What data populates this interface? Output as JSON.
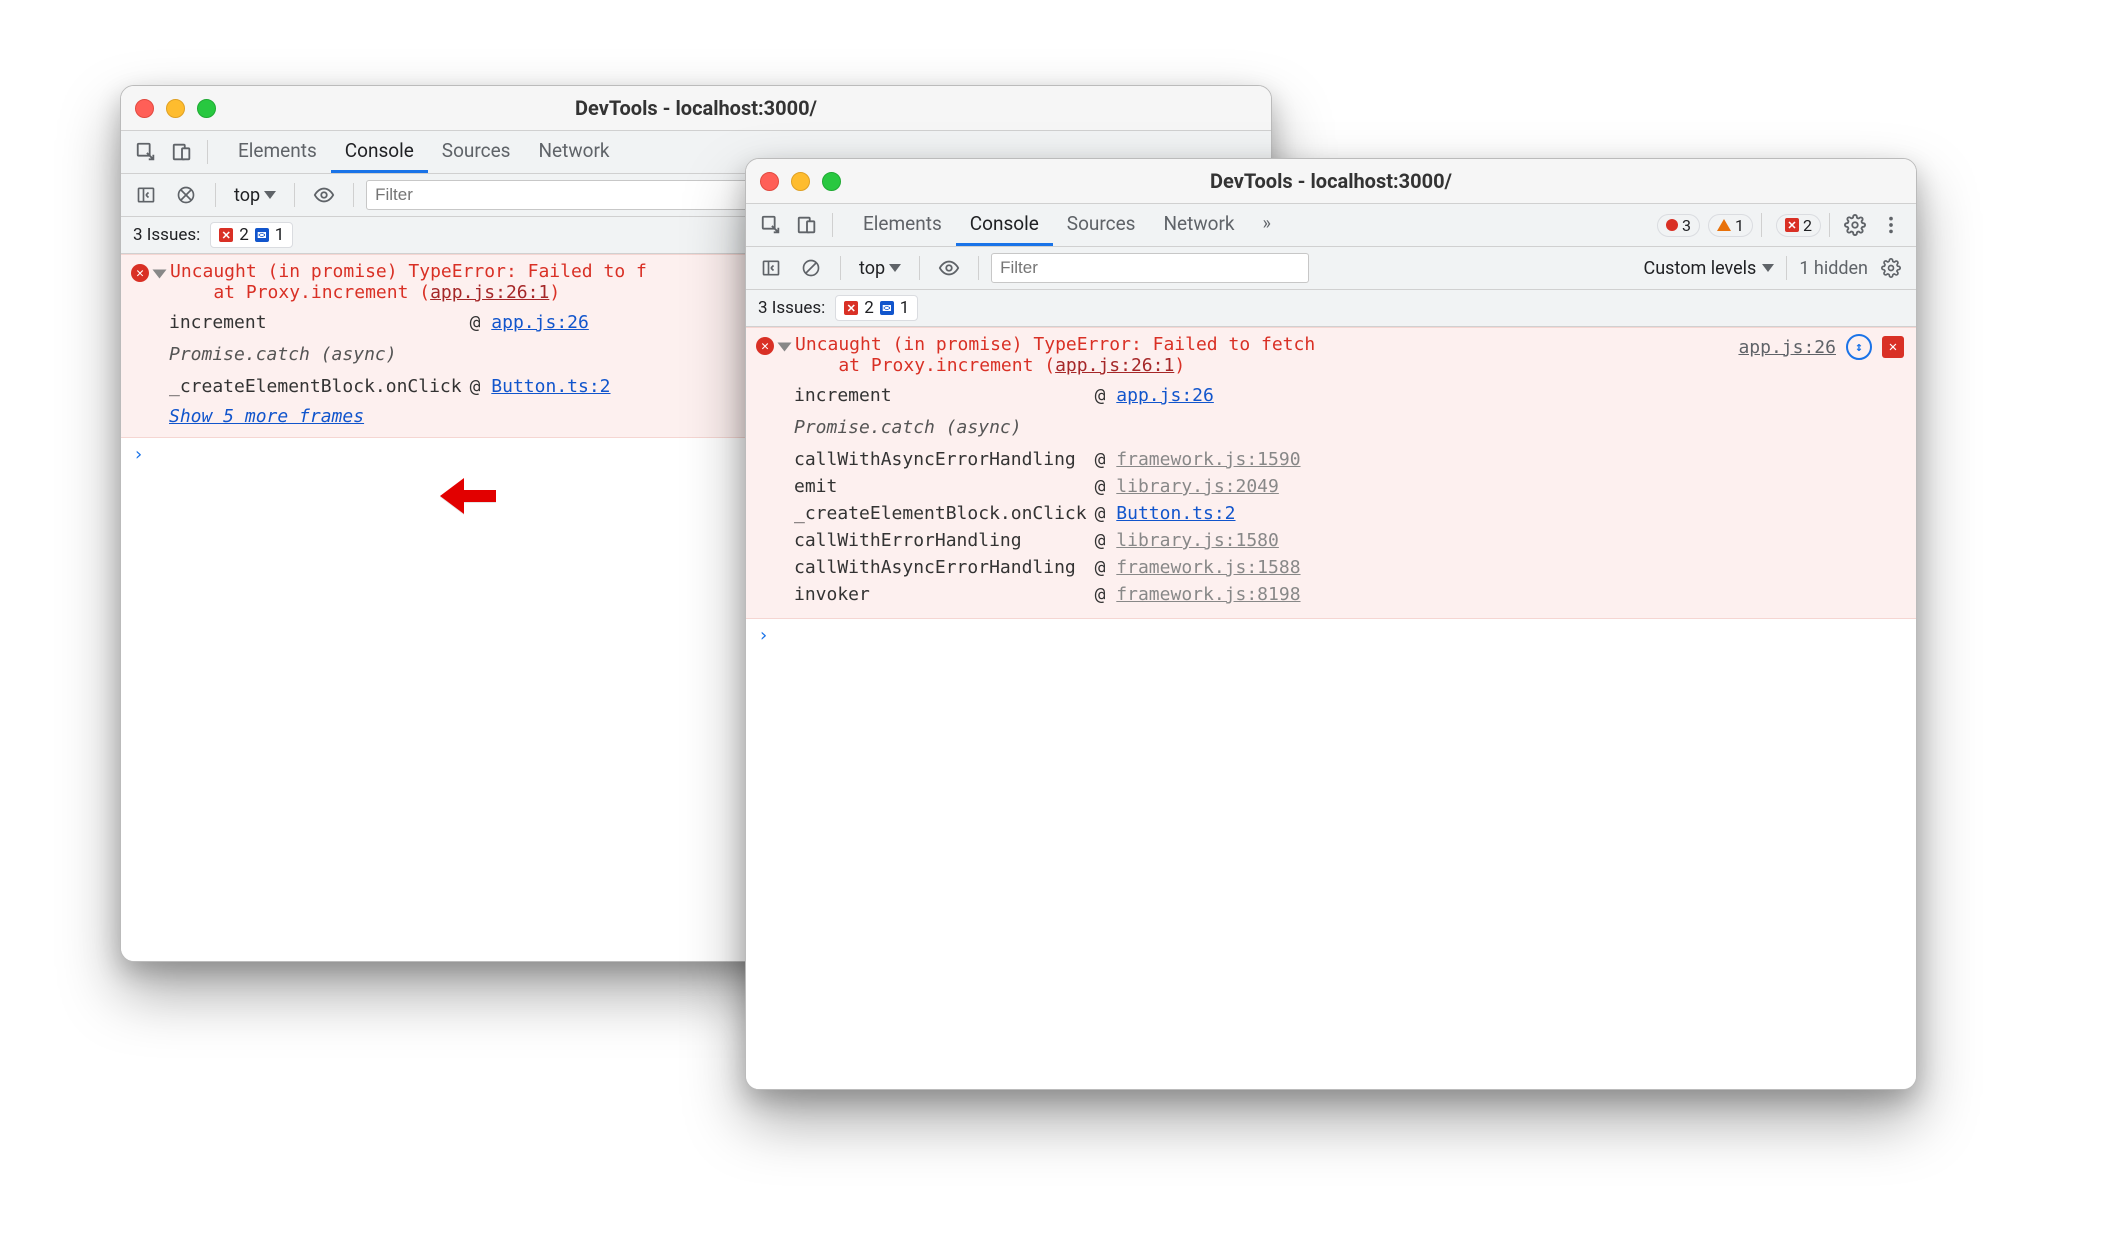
{
  "window_back": {
    "title": "DevTools - localhost:3000/",
    "tabs": {
      "elements": "Elements",
      "console": "Console",
      "sources": "Sources",
      "network": "Network"
    },
    "context": "top",
    "filter_placeholder": "Filter",
    "issues_label": "3 Issues:",
    "issues_err_count": "2",
    "issues_msg_count": "1",
    "error_header": "Uncaught (in promise) TypeError: Failed to f\n    at Proxy.increment (",
    "error_src_label": "app.js:26:1",
    "error_tail": ")",
    "stack": [
      {
        "fn": "increment",
        "at": "@",
        "loc": "app.js:26"
      }
    ],
    "async_label": "Promise.catch (async)",
    "stack2": [
      {
        "fn": "_createElementBlock.onClick",
        "at": "@",
        "loc": "Button.ts:2"
      }
    ],
    "show_more": "Show 5 more frames",
    "prompt": "›"
  },
  "window_front": {
    "title": "DevTools - localhost:3000/",
    "tabs": {
      "elements": "Elements",
      "console": "Console",
      "sources": "Sources",
      "network": "Network"
    },
    "counts": {
      "errors": "3",
      "warnings": "1",
      "redsq": "2"
    },
    "context": "top",
    "filter_placeholder": "Filter",
    "custom_levels": "Custom levels",
    "hidden": "1 hidden",
    "issues_label": "3 Issues:",
    "issues_err_count": "2",
    "issues_msg_count": "1",
    "error_header": "Uncaught (in promise) TypeError: Failed to fetch\n    at Proxy.increment (",
    "error_src_label": "app.js:26:1",
    "error_tail": ")",
    "right_src": "app.js:26",
    "stack": [
      {
        "fn": "increment",
        "at": "@",
        "loc": "app.js:26",
        "link_strong": true
      }
    ],
    "async_label": "Promise.catch (async)",
    "stack2": [
      {
        "fn": "callWithAsyncErrorHandling",
        "at": "@",
        "loc": "framework.js:1590"
      },
      {
        "fn": "emit",
        "at": "@",
        "loc": "library.js:2049"
      },
      {
        "fn": "_createElementBlock.onClick",
        "at": "@",
        "loc": "Button.ts:2",
        "link_strong": true
      },
      {
        "fn": "callWithErrorHandling",
        "at": "@",
        "loc": "library.js:1580"
      },
      {
        "fn": "callWithAsyncErrorHandling",
        "at": "@",
        "loc": "framework.js:1588"
      },
      {
        "fn": "invoker",
        "at": "@",
        "loc": "framework.js:8198"
      }
    ],
    "prompt": "›"
  }
}
